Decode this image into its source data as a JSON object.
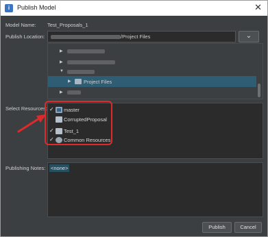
{
  "window": {
    "title": "Publish Model",
    "app_icon": "info-icon",
    "close_glyph": "✕"
  },
  "form": {
    "model_name_label": "Model Name:",
    "model_name_value": "Test_Proposals_1",
    "publish_location_label": "Publish Location:",
    "publish_location_value": "/Project Files",
    "expand_glyph": "⌄",
    "select_resources_label": "Select Resources:",
    "publishing_notes_label": "Publishing Notes:",
    "publishing_notes_value": "<none>"
  },
  "tree": {
    "selected_item": "Project Files"
  },
  "resources": [
    {
      "label": "master",
      "checked": true,
      "icon": "database-icon"
    },
    {
      "label": "CorruptedProposal",
      "checked": false,
      "icon": "folder-icon"
    },
    {
      "label": "Test_1",
      "checked": true,
      "icon": "folder-icon"
    },
    {
      "label": "Common Resources",
      "checked": true,
      "icon": "shared-resources-icon"
    }
  ],
  "check_glyph": "✓",
  "buttons": {
    "publish": "Publish",
    "cancel": "Cancel"
  },
  "colors": {
    "annotation": "#e02a2a",
    "dialog_background": "#3c3f41",
    "selection": "#2f5d73"
  }
}
